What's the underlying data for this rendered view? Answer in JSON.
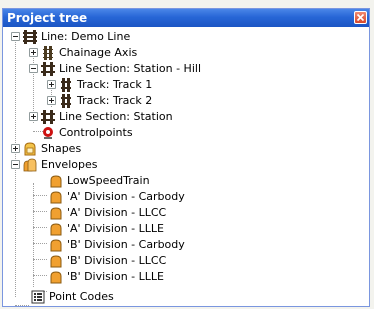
{
  "panel": {
    "title": "Project tree"
  },
  "tree": {
    "root": "Line: Demo Line",
    "chainage_axis": "Chainage Axis",
    "section_hill": "Line Section: Station - Hill",
    "track1": "Track: Track 1",
    "track2": "Track: Track 2",
    "section_station": "Line Section: Station",
    "controlpoints": "Controlpoints",
    "shapes": "Shapes",
    "envelopes": "Envelopes",
    "envelope_items": [
      "LowSpeedTrain",
      "'A' Division - Carbody",
      "'A' Division - LLCC",
      "'A' Division - LLLE",
      "'B' Division - Carbody",
      "'B' Division - LLCC",
      "'B' Division - LLLE"
    ],
    "point_codes": "Point Codes"
  },
  "colors": {
    "titlebar": "#2766d6",
    "envelope_icon": "#f0a030",
    "controlpoint_icon": "#cc1111"
  }
}
